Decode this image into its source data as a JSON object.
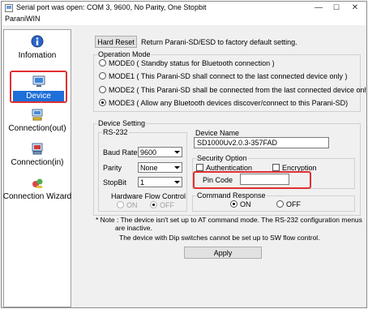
{
  "window": {
    "title": "Serial port was open: COM 3, 9600, No Parity, One Stopbit",
    "menu_label": "ParaniWIN",
    "minimize": "—",
    "maximize": "☐",
    "close": "✕"
  },
  "sidebar": {
    "items": [
      {
        "label": "Infomation",
        "icon": "info-icon"
      },
      {
        "label": "Device Setting",
        "icon": "device-setting-icon",
        "selected": true
      },
      {
        "label": "Connection(out)",
        "icon": "connection-out-icon"
      },
      {
        "label": "Connection(in)",
        "icon": "connection-in-icon"
      },
      {
        "label": "Connection Wizard",
        "icon": "connection-wizard-icon"
      }
    ]
  },
  "reset": {
    "button_label": "Hard Reset",
    "description": "Return Parani-SD/ESD to factory default setting."
  },
  "operation_mode": {
    "title": "Operation Mode",
    "options": [
      {
        "label": "MODE0 ( Standby status for Bluetooth connection )",
        "selected": false
      },
      {
        "label": "MODE1 ( This Parani-SD shall connect to the last connected device only )",
        "selected": false
      },
      {
        "label": "MODE2 ( This Parani-SD shall be connected from the last connected device only )",
        "selected": false
      },
      {
        "label": "MODE3 ( Allow any Bluetooth devices discover/connect to this Parani-SD)",
        "selected": true
      }
    ]
  },
  "device_setting": {
    "title": "Device Setting",
    "rs232": {
      "title": "RS-232",
      "baud_rate_label": "Baud Rate",
      "baud_rate_value": "9600",
      "parity_label": "Parity",
      "parity_value": "None",
      "stopbit_label": "StopBit",
      "stopbit_value": "1",
      "hw_flow_label": "Hardware Flow Control",
      "hw_flow_on": "ON",
      "hw_flow_off": "OFF"
    },
    "device_name_label": "Device Name",
    "device_name_value": "SD1000Uv2.0.3-357FAD",
    "security": {
      "title": "Security Option",
      "authentication_label": "Authentication",
      "encryption_label": "Encryption",
      "pin_code_label": "Pin Code",
      "pin_code_value": ""
    },
    "command_response": {
      "title": "Command Response",
      "on_label": "ON",
      "off_label": "OFF",
      "selected": "ON"
    }
  },
  "notes": {
    "line1": "* Note : The device isn't set up to AT command mode. The RS-232 configuration menus",
    "line2": "are inactive.",
    "line3": "The device with Dip switches cannot be set up to SW flow control."
  },
  "apply_label": "Apply",
  "colors": {
    "highlight_red": "#e03030",
    "selection_blue": "#1e6fd9"
  }
}
